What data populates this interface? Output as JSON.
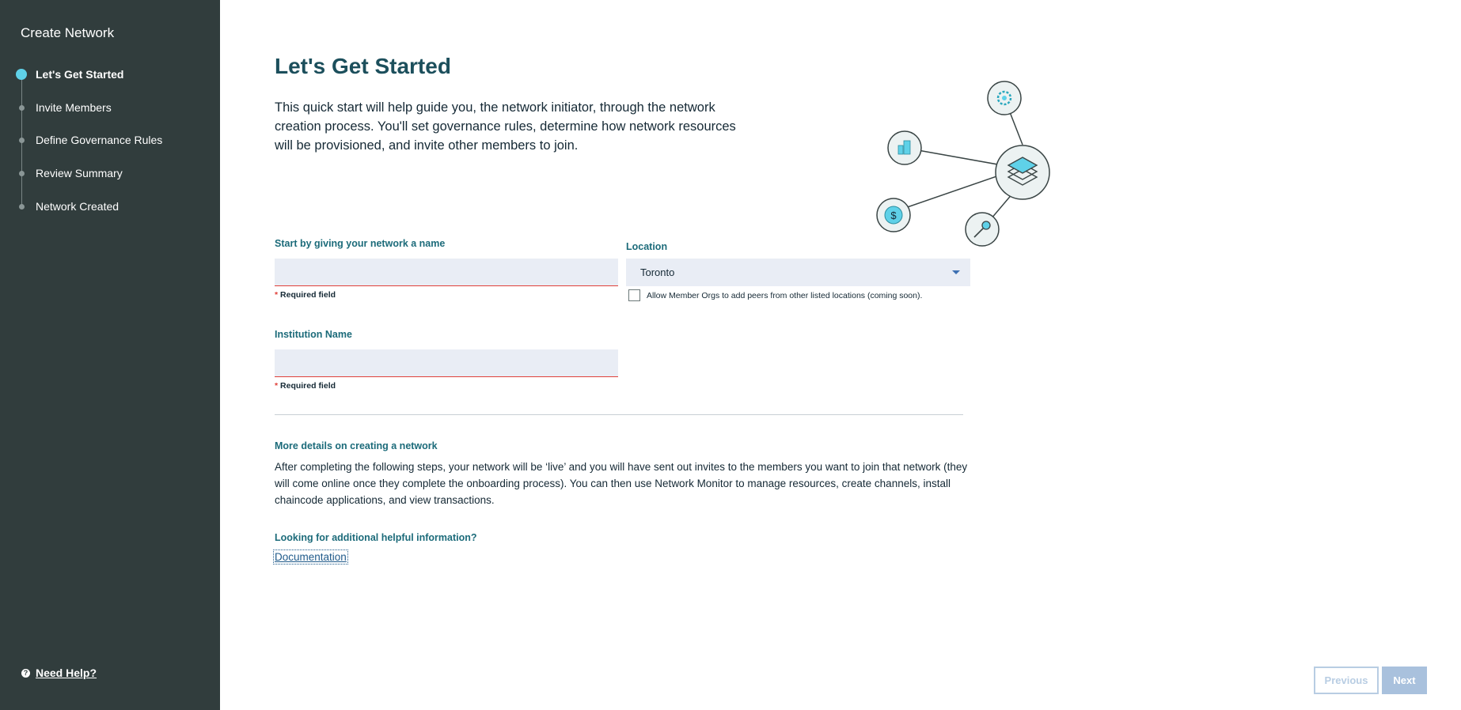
{
  "sidebar": {
    "title": "Create Network",
    "steps": [
      {
        "label": "Let's Get Started",
        "active": true
      },
      {
        "label": "Invite Members",
        "active": false
      },
      {
        "label": "Define Governance Rules",
        "active": false
      },
      {
        "label": "Review Summary",
        "active": false
      },
      {
        "label": "Network Created",
        "active": false
      }
    ],
    "help_label": "Need Help?",
    "help_icon": "?"
  },
  "main": {
    "title": "Let's Get Started",
    "intro": "This quick start will help guide you, the network initiator, through the network creation process. You'll set governance rules, determine how network resources will be provisioned, and invite other members to join.",
    "network_name": {
      "label": "Start by giving your network a name",
      "value": "",
      "required_star": "*",
      "required_text": "Required field"
    },
    "location": {
      "label": "Location",
      "selected": "Toronto",
      "checkbox_label": "Allow Member Orgs to add peers from other listed locations (coming soon).",
      "checked": false
    },
    "institution": {
      "label": "Institution Name",
      "value": "",
      "required_star": "*",
      "required_text": "Required field"
    },
    "details": {
      "title": "More details on creating a network",
      "body": "After completing the following steps, your network will be ‘live’ and you will have sent out invites to the members you want to join that network (they will come online once they complete the onboarding process). You can then use Network Monitor to manage resources, create channels, install chaincode applications, and view transactions."
    },
    "info": {
      "title": "Looking for additional helpful information?",
      "link": "Documentation"
    },
    "illustration": {
      "nodes": [
        "gear-icon",
        "building-icon",
        "layers-icon",
        "dollar-icon",
        "key-icon"
      ],
      "accent": "#5fd1e8",
      "dollar_symbol": "$"
    }
  },
  "footer": {
    "previous_label": "Previous",
    "next_label": "Next"
  },
  "colors": {
    "sidebar_bg": "#313d3d",
    "title": "#1c4f5c",
    "label": "#1c6b7a",
    "input_bg": "#e9edf5",
    "error": "#e0413a",
    "active_step": "#5fd1e8",
    "button_disabled": "#a9c1dd"
  }
}
